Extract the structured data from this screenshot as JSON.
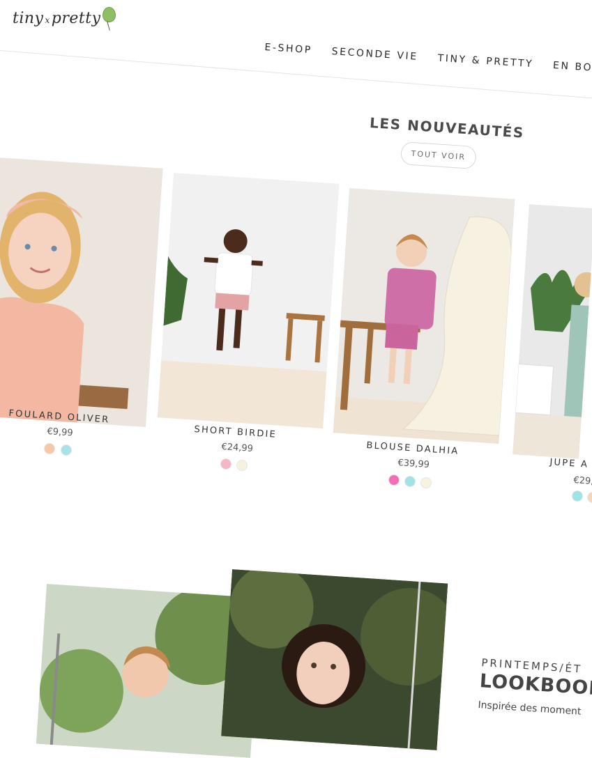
{
  "brand": {
    "logo_text_1": "tiny",
    "logo_x": "x",
    "logo_text_2": "pretty"
  },
  "nav": {
    "items": [
      {
        "label": "E-SHOP"
      },
      {
        "label": "SECONDE VIE"
      },
      {
        "label": "TINY & PRETTY"
      },
      {
        "label": "EN BOU"
      }
    ]
  },
  "new_arrivals": {
    "title": "LES NOUVEAUTÉS",
    "see_all": "TOUT VOIR",
    "products": [
      {
        "name": "FOULARD OLIVER",
        "price": "€9,99",
        "colors": [
          "#f5c9a6",
          "#a7e3e6"
        ]
      },
      {
        "name": "SHORT BIRDIE",
        "price": "€24,99",
        "colors": [
          "#f7b6c7",
          "#f7f1e0"
        ]
      },
      {
        "name": "BLOUSE DALHIA",
        "price": "€39,99",
        "colors": [
          "#f36db9",
          "#9fe3e6",
          "#f7f2e2"
        ]
      },
      {
        "name": "JUPE A",
        "price": "€29,",
        "colors": [
          "#9fe3e6",
          "#f5d7b8"
        ]
      }
    ]
  },
  "lookbook": {
    "kicker": "PRINTEMPS/ÉT",
    "title": "LOOKBOOK",
    "description": "Inspirée des moment"
  }
}
